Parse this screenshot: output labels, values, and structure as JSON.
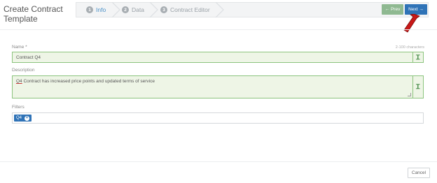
{
  "page": {
    "title": "Create Contract Template"
  },
  "wizard": {
    "steps": [
      {
        "num": "1",
        "label": "Info"
      },
      {
        "num": "2",
        "label": "Data"
      },
      {
        "num": "3",
        "label": "Contract Editor"
      }
    ],
    "prev_label": "← Prev",
    "next_label": "Next →"
  },
  "form": {
    "name_label": "Name *",
    "char_count": "2-100 characters",
    "name_value": "Contract Q4",
    "description_label": "Description",
    "description_underlined": "Q4",
    "description_rest": " Contract has increased price points and updated terms of service",
    "text_format_icon": "Ꮖ",
    "filters_label": "Filters",
    "filter_chip": "Q4",
    "chip_remove": "×"
  },
  "footer": {
    "cancel_label": "Cancel"
  },
  "colors": {
    "accent": "#2f73b7",
    "prev": "#8fb991",
    "valid_bg": "#eef5e6",
    "valid_border": "#8cc47e",
    "annotation": "#d01c1c"
  }
}
